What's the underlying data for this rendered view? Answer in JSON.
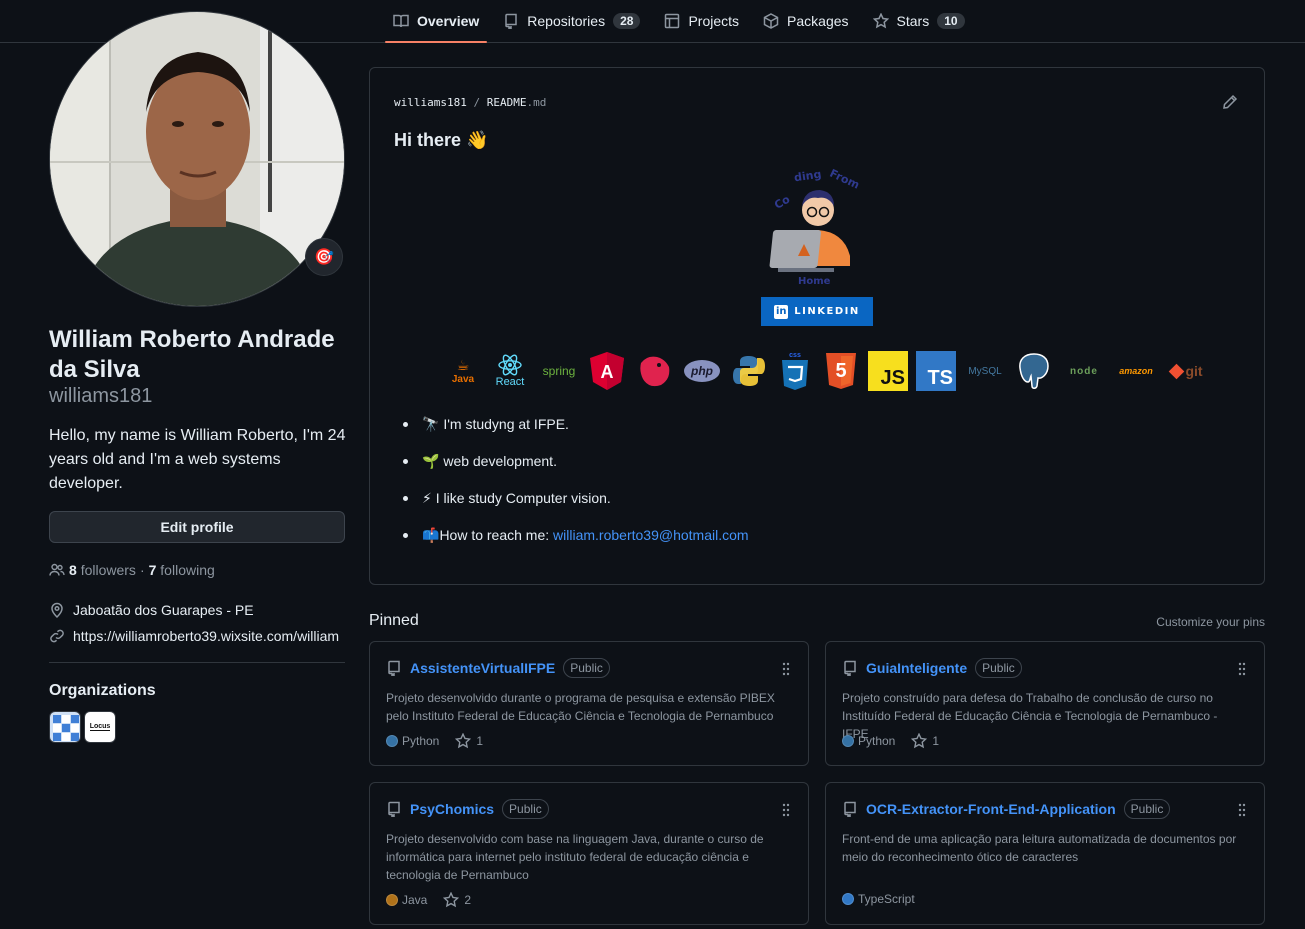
{
  "nav": {
    "tabs": [
      {
        "label": "Overview",
        "icon": "book-icon",
        "counter": null
      },
      {
        "label": "Repositories",
        "icon": "repo-icon",
        "counter": "28"
      },
      {
        "label": "Projects",
        "icon": "table-icon",
        "counter": null
      },
      {
        "label": "Packages",
        "icon": "package-icon",
        "counter": null
      },
      {
        "label": "Stars",
        "icon": "star-icon",
        "counter": "10"
      }
    ]
  },
  "profile": {
    "full_name": "William Roberto Andrade da Silva",
    "username": "williams181",
    "bio": "Hello, my name is William Roberto, I'm 24 years old and I'm a web systems developer.",
    "edit_label": "Edit profile",
    "followers_count": "8",
    "followers_label": "followers",
    "following_count": "7",
    "following_label": "following",
    "separator": "·",
    "location": "Jaboatão dos Guarapes - PE",
    "website": "https://williamroberto39.wixsite.com/william",
    "status_emoji": "🎯",
    "organizations_title": "Organizations",
    "org2_label": "Locus"
  },
  "readme": {
    "path_user": "williams181",
    "path_sep": "/",
    "path_file": "README",
    "path_ext": ".md",
    "greeting": "Hi there 👋",
    "linkedin_label": "LINKEDIN",
    "linkedin_in": "in",
    "techs": [
      "Java",
      "React",
      "spring",
      "A",
      "nest",
      "php",
      "python",
      "css",
      "5",
      "JS",
      "TS",
      "MySQL",
      "postgres",
      "node",
      "amazon",
      "git"
    ],
    "bullets": [
      {
        "emoji": "🔭",
        "text": "I'm studyng at IFPE."
      },
      {
        "emoji": "🌱",
        "text": "web development."
      },
      {
        "emoji": "⚡",
        "text": "I like study Computer vision."
      },
      {
        "emoji": "📫",
        "text": "How to reach me: ",
        "link": "william.roberto39@hotmail.com"
      }
    ]
  },
  "pinned": {
    "title": "Pinned",
    "customize_label": "Customize your pins",
    "repos": [
      {
        "name": "AssistenteVirtualIFPE",
        "visibility": "Public",
        "description": "Projeto desenvolvido durante o programa de pesquisa e extensão PIBEX pelo Instituto Federal de Educação Ciência e Tecnologia de Pernambuco",
        "language": "Python",
        "language_color": "#3572A5",
        "stars": "1"
      },
      {
        "name": "GuiaInteligente",
        "visibility": "Public",
        "description": "Projeto construído para defesa do Trabalho de conclusão de curso no Instituído Federal de Educação Ciência e Tecnologia de Pernambuco - IFPE",
        "language": "Python",
        "language_color": "#3572A5",
        "stars": "1"
      },
      {
        "name": "PsyChomics",
        "visibility": "Public",
        "description": "Projeto desenvolvido com base na linguagem Java, durante o curso de informática para internet pelo instituto federal de educação ciência e tecnologia de Pernambuco",
        "language": "Java",
        "language_color": "#b07219",
        "stars": "2"
      },
      {
        "name": "OCR-Extractor-Front-End-Application",
        "visibility": "Public",
        "description": "Front-end de uma aplicação para leitura automatizada de documentos por meio do reconhecimento ótico de caracteres",
        "language": "TypeScript",
        "language_color": "#3178c6",
        "stars": null
      }
    ]
  }
}
